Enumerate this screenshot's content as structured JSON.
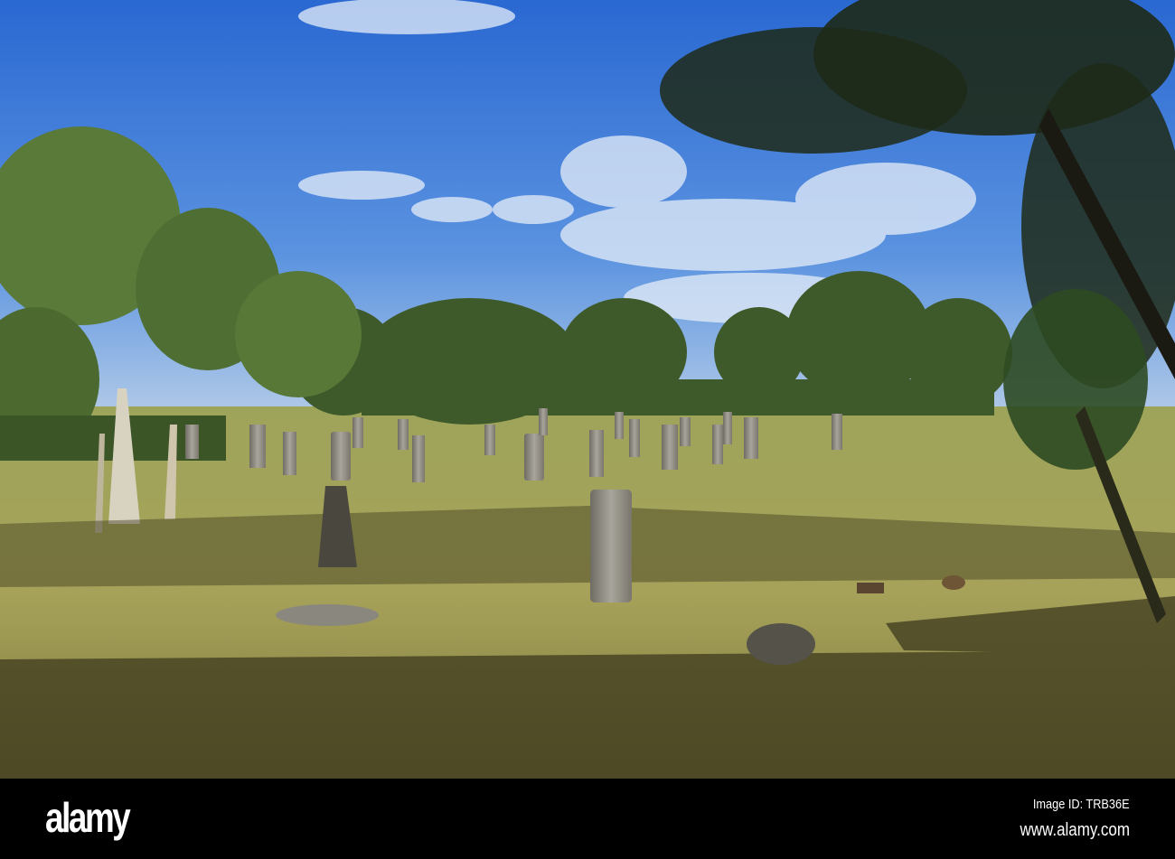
{
  "watermark": {
    "logo": "alamy",
    "image_id": "Image ID: TRB36E",
    "website": "www.alamy.com"
  },
  "colors": {
    "sky_top": "#2f6fd6",
    "sky_bottom": "#a8c8ee",
    "grass": "#a8a35a",
    "shadow": "#3d3a1e",
    "bar": "#000000"
  }
}
